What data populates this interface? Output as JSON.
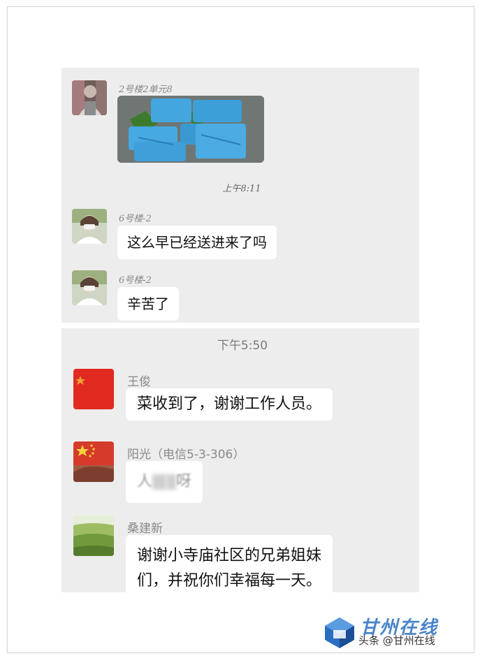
{
  "panel1": {
    "messages": [
      {
        "sender": "2号楼2单元8",
        "type": "image"
      },
      {
        "sender": "6号楼-2",
        "text": "这么早已经送进来了吗"
      },
      {
        "sender": "6号楼-2",
        "text": "辛苦了"
      }
    ],
    "timestamp": "上午8:11"
  },
  "panel2": {
    "timestamp": "下午5:50",
    "messages": [
      {
        "sender": "王俊",
        "text": "菜收到了，谢谢工作人员。"
      },
      {
        "sender": "阳光（电信5-3-306）",
        "text_start": "人",
        "text_end": "呀"
      },
      {
        "sender": "桑建新",
        "text_lines": [
          "谢谢小寺庙社区的兄弟姐妹",
          "们，并祝你们幸福每一天。"
        ]
      }
    ]
  },
  "watermark": {
    "logo_text": "甘州在线",
    "caption": "头条 @甘州在线"
  },
  "colors": {
    "chat_bg": "#ededed",
    "bubble_bg": "#ffffff",
    "bag_blue": "#43a6df",
    "flag_red": "#e02a1f"
  }
}
